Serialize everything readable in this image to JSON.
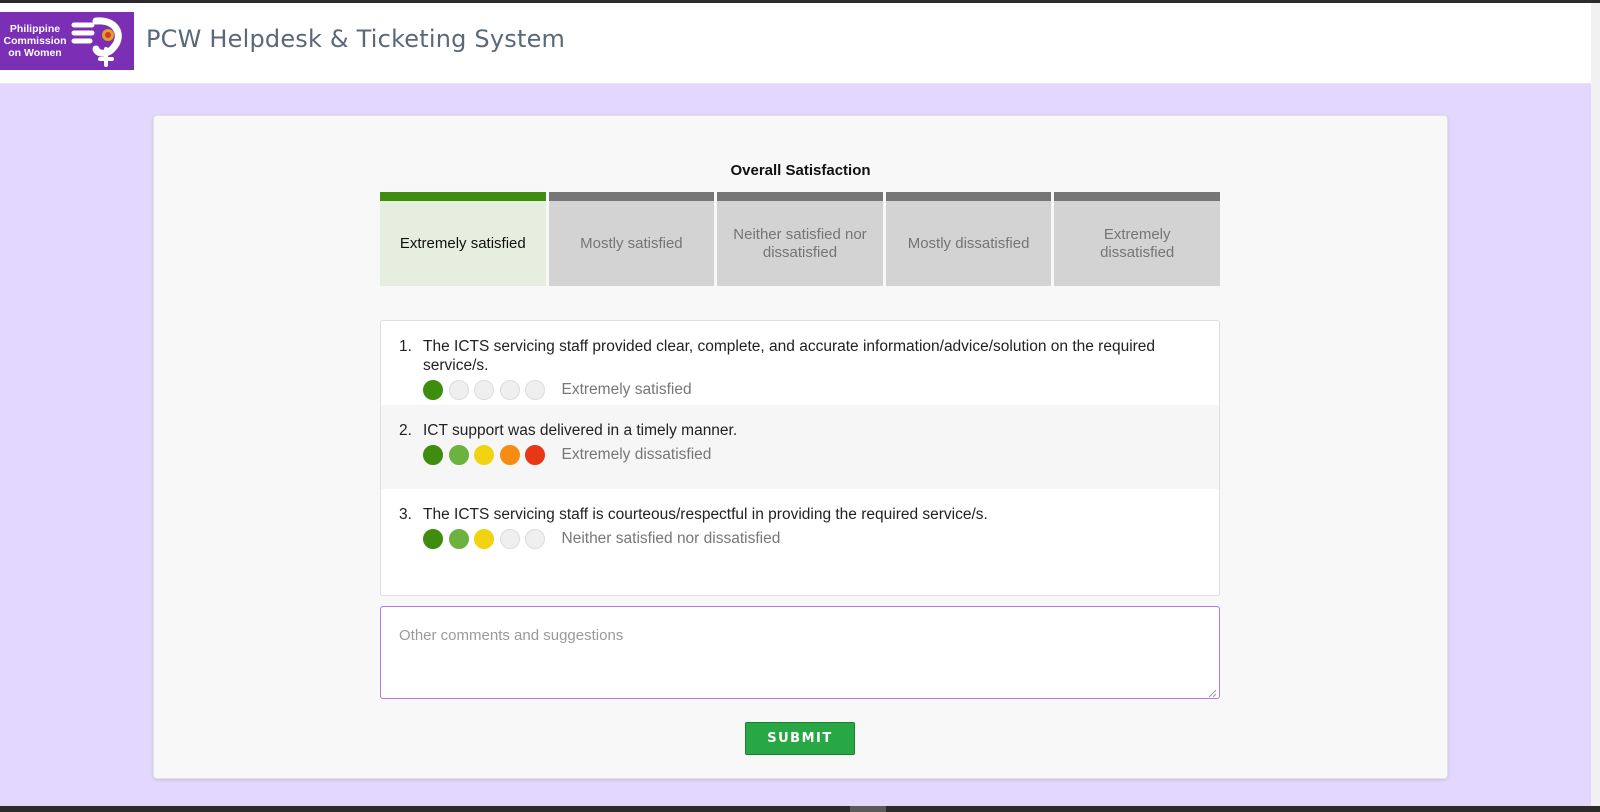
{
  "header": {
    "logo_text": "Philippine Commission on Women",
    "title": "PCW Helpdesk & Ticketing System"
  },
  "overall": {
    "title": "Overall Satisfaction",
    "selected_index": 0,
    "options": [
      "Extremely satisfied",
      "Mostly satisfied",
      "Neither satisfied nor dissatisfied",
      "Mostly dissatisfied",
      "Extremely dissatisfied"
    ]
  },
  "questions": [
    {
      "number": "1.",
      "text": "The ICTS servicing staff provided clear, complete, and accurate information/advice/solution on the required service/s.",
      "filled": 1,
      "rating_label": "Extremely satisfied"
    },
    {
      "number": "2.",
      "text": "ICT support was delivered in a timely manner.",
      "filled": 5,
      "rating_label": "Extremely dissatisfied"
    },
    {
      "number": "3.",
      "text": "The ICTS servicing staff is courteous/respectful in providing the required service/s.",
      "filled": 3,
      "rating_label": "Neither satisfied nor dissatisfied"
    }
  ],
  "comments": {
    "placeholder": "Other comments and suggestions",
    "value": ""
  },
  "submit_label": "SUBMIT",
  "colors": {
    "rating_1": "#3e8d0e",
    "rating_2": "#6bb23f",
    "rating_3": "#f0d411",
    "rating_4": "#f68c13",
    "rating_5": "#e63717",
    "page_background": "#e3d7fd",
    "logo_background": "#7a2fb5",
    "submit": "#28a745"
  }
}
